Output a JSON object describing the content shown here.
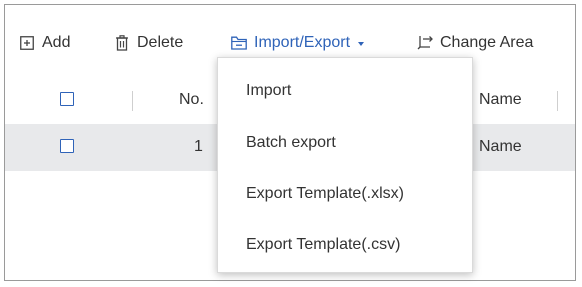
{
  "toolbar": {
    "add_label": "Add",
    "delete_label": "Delete",
    "import_export_label": "Import/Export",
    "change_area_label": "Change Area"
  },
  "table": {
    "columns": [
      "No.",
      "Name"
    ],
    "rows": [
      {
        "no": "1",
        "name": "Name"
      }
    ]
  },
  "dropdown": {
    "items": [
      "Import",
      "Batch export",
      "Export Template(.xlsx)",
      "Export Template(.csv)"
    ]
  },
  "colors": {
    "accent": "#2f63b8",
    "row_highlight": "#e8e9eb",
    "border": "#9a9a9a"
  }
}
